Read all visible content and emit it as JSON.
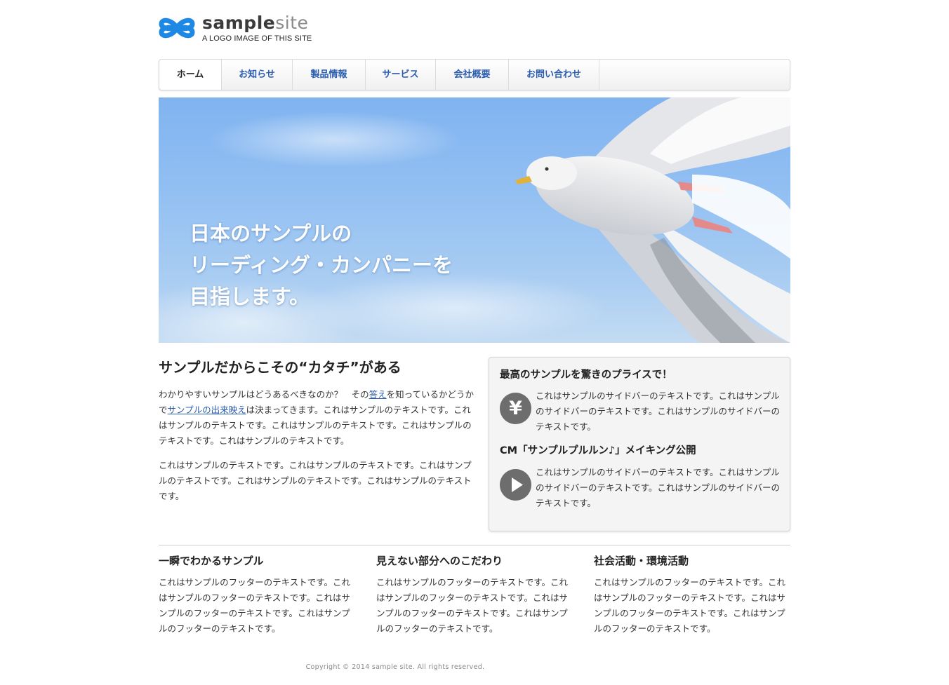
{
  "header": {
    "logo_name_a": "sample",
    "logo_name_b": "site",
    "logo_tagline": "A LOGO IMAGE OF THIS SITE",
    "logo_icon": "double-loop-logo-icon",
    "accent_color": "#1e88e5"
  },
  "nav": {
    "items": [
      {
        "label": "ホーム",
        "active": true
      },
      {
        "label": "お知らせ"
      },
      {
        "label": "製品情報"
      },
      {
        "label": "サービス"
      },
      {
        "label": "会社概要"
      },
      {
        "label": "お問い合わせ"
      }
    ],
    "link_color": "#2a5db0"
  },
  "hero": {
    "line1": "日本のサンプルの",
    "line2": "リーディング・カンパニーを",
    "line3": "目指します。"
  },
  "main": {
    "title": "サンプルだからこその“カタチ”がある",
    "p1_a": "わかりやすいサンプルはどうあるべきなのか？　その",
    "p1_link1": "答え",
    "p1_b": "を知っているかどうかで",
    "p1_link2": "サンプルの出来映え",
    "p1_c": "は決まってきます。これはサンプルのテキストです。これはサンプルのテキストです。これはサンプルのテキストです。これはサンプルのテキストです。これはサンプルのテキストです。",
    "p2": "これはサンプルのテキストです。これはサンプルのテキストです。これはサンプルのテキストです。これはサンプルのテキストです。これはサンプルのテキストです。"
  },
  "sidebar": {
    "h1": "最高のサンプルを驚きのプライスで！",
    "icon1": "yen-icon",
    "icon1_glyph": "¥",
    "text1": "これはサンプルのサイドバーのテキストです。これはサンプルのサイドバーのテキストです。これはサンプルのサイドバーのテキストです。",
    "h2": "CM「サンプルプルルン♪」メイキング公開",
    "icon2": "play-icon",
    "text2": "これはサンプルのサイドバーのテキストです。これはサンプルのサイドバーのテキストです。これはサンプルのサイドバーのテキストです。"
  },
  "footer": {
    "cols": [
      {
        "title": "一瞬でわかるサンプル",
        "text": "これはサンプルのフッターのテキストです。これはサンプルのフッターのテキストです。これはサンプルのフッターのテキストです。これはサンプルのフッターのテキストです。"
      },
      {
        "title": "見えない部分へのこだわり",
        "text": "これはサンプルのフッターのテキストです。これはサンプルのフッターのテキストです。これはサンプルのフッターのテキストです。これはサンプルのフッターのテキストです。"
      },
      {
        "title": "社会活動・環境活動",
        "text": "これはサンプルのフッターのテキストです。これはサンプルのフッターのテキストです。これはサンプルのフッターのテキストです。これはサンプルのフッターのテキストです。"
      }
    ],
    "copyright": "Copyright © 2014 sample site. All rights reserved."
  }
}
